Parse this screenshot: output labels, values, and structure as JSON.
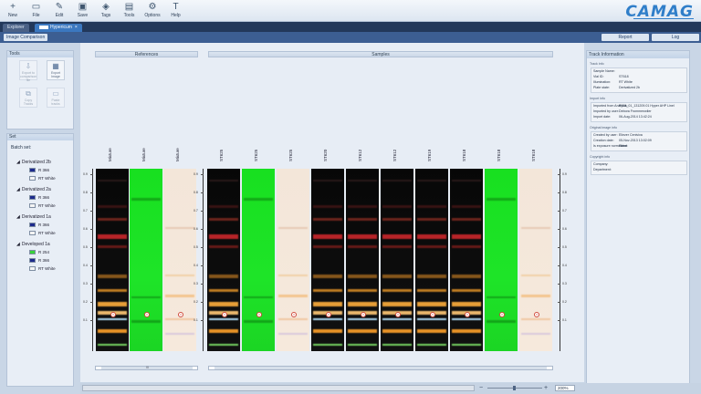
{
  "toolbar": {
    "buttons": [
      {
        "id": "new",
        "label": "New",
        "icon": "+"
      },
      {
        "id": "file",
        "label": "File",
        "icon": "▭"
      },
      {
        "id": "edit",
        "label": "Edit",
        "icon": "✎"
      },
      {
        "id": "save",
        "label": "Save",
        "icon": "▣"
      },
      {
        "id": "tags",
        "label": "Tags",
        "icon": "◈"
      },
      {
        "id": "tools",
        "label": "Tools",
        "icon": "▤"
      },
      {
        "id": "options",
        "label": "Options",
        "icon": "⚙"
      },
      {
        "id": "help",
        "label": "Help",
        "icon": "T"
      }
    ],
    "logo": "CAMAG"
  },
  "tabs": [
    {
      "label": "Explorer",
      "active": false
    },
    {
      "label": "Hypericum",
      "active": true,
      "close": "×"
    }
  ],
  "header": {
    "view_title": "Image Comparison",
    "report_label": "Report",
    "log_label": "Log"
  },
  "tools_panel": {
    "title": "Tools",
    "items": [
      {
        "label": "Export to comparison file",
        "icon": "⇩",
        "enabled": false
      },
      {
        "label": "Export Image",
        "icon": "▦",
        "enabled": true
      },
      {
        "label": "Copy Tracks",
        "icon": "⧉",
        "enabled": false
      },
      {
        "label": "Paste tracks",
        "icon": "▭",
        "enabled": false
      }
    ]
  },
  "set_panel": {
    "title": "Set",
    "batch_label": "Batch set:",
    "groups": [
      {
        "name": "Derivatized 2b",
        "items": [
          {
            "label": "R 366",
            "color": "#1d2a8c"
          },
          {
            "label": "RT White",
            "color": "#f4f4f4"
          }
        ]
      },
      {
        "name": "Derivatized 2a",
        "items": [
          {
            "label": "R 366",
            "color": "#1d2a8c"
          },
          {
            "label": "RT White",
            "color": "#f4f4f4"
          }
        ]
      },
      {
        "name": "Derivatized 1a",
        "items": [
          {
            "label": "R 366",
            "color": "#1d2a8c"
          },
          {
            "label": "RT White",
            "color": "#f4f4f4"
          }
        ]
      },
      {
        "name": "Developed 1a",
        "items": [
          {
            "label": "R 254",
            "color": "#37d33a"
          },
          {
            "label": "R 366",
            "color": "#1d2a8c"
          },
          {
            "label": "RT White",
            "color": "#f4f4f4"
          }
        ]
      }
    ]
  },
  "plates": {
    "references_title": "References",
    "samples_title": "Samples",
    "references": [
      {
        "label": "Mixture",
        "type": "uv366"
      },
      {
        "label": "Mixture",
        "type": "uv254"
      },
      {
        "label": "Mixture",
        "type": "white"
      }
    ],
    "samples": [
      {
        "label": "ST625",
        "type": "uv366"
      },
      {
        "label": "ST625",
        "type": "uv254"
      },
      {
        "label": "ST625",
        "type": "white"
      },
      {
        "label": "ST620",
        "type": "uv366"
      },
      {
        "label": "ST612",
        "type": "uv366"
      },
      {
        "label": "ST612",
        "type": "uv366"
      },
      {
        "label": "ST619",
        "type": "uv366"
      },
      {
        "label": "ST618",
        "type": "uv366"
      },
      {
        "label": "ST618",
        "type": "uv254"
      },
      {
        "label": "ST618",
        "type": "white"
      }
    ],
    "rf_ticks": [
      "0.9",
      "0.8",
      "0.7",
      "0.6",
      "0.5",
      "0.4",
      "0.3",
      "0.2",
      "0.1"
    ],
    "ref_scroll_mark": "III"
  },
  "track_info": {
    "title": "Track Information",
    "sections": [
      {
        "heading": "Track info",
        "rows": [
          {
            "k": "Sample Name:",
            "v": ""
          },
          {
            "k": "Vial ID:",
            "v": "ST618"
          },
          {
            "k": "Illumination:",
            "v": "RT White"
          },
          {
            "k": "Plate state:",
            "v": "Derivatized 2b"
          }
        ]
      },
      {
        "heading": "Import info",
        "rows": [
          {
            "k": "Imported from Analysis:",
            "v": "P154_01_131209.01 Hyper AHP Linel"
          },
          {
            "k": "Imported by user:",
            "v": "Debora Frommenwiler"
          },
          {
            "k": "Import date:",
            "v": "06-Aug-2014 13:42:24"
          }
        ]
      },
      {
        "heading": "Original image info",
        "rows": [
          {
            "k": "Created by user:",
            "v": "Eliezer Ceniviva"
          },
          {
            "k": "Creation date:",
            "v": "05-Nov-2013 13:02:09"
          },
          {
            "k": "Is exposure normalized:",
            "v": "False"
          }
        ]
      },
      {
        "heading": "Copyright info",
        "rows": [
          {
            "k": "Company:",
            "v": ""
          },
          {
            "k": "Department:",
            "v": ""
          }
        ]
      }
    ]
  },
  "statusbar": {
    "zoom_value": "200%",
    "zoom_out": "−",
    "zoom_in": "+"
  }
}
